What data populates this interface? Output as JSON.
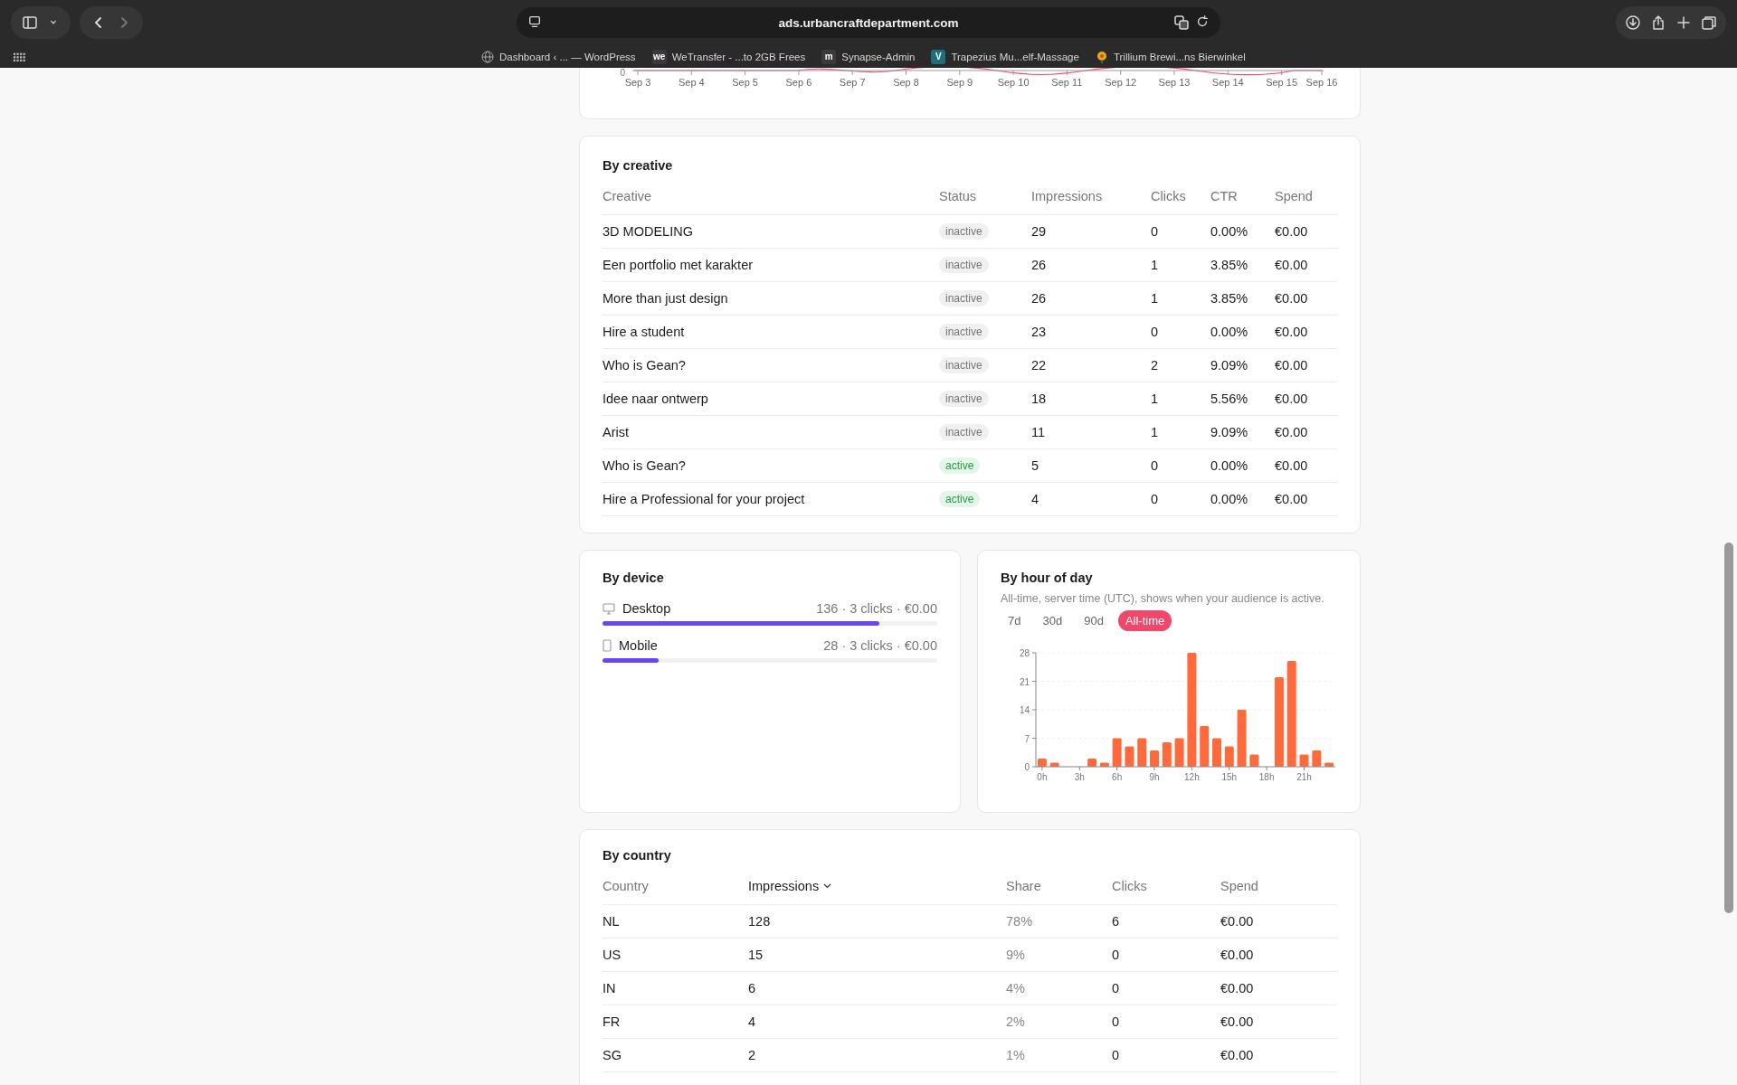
{
  "browser": {
    "url": "ads.urbancraftdepartment.com",
    "back_disabled": false,
    "forward_disabled": true,
    "bookmarks": [
      {
        "kind": "globe",
        "label": "Dashboard ‹ ... — WordPress"
      },
      {
        "kind": "badge",
        "badge": "we",
        "color": "#3a3a3a",
        "label": "WeTransfer - ...to 2GB Frees"
      },
      {
        "kind": "badge",
        "badge": "m",
        "color": "#3a3a3a",
        "label": "Synapse-Admin"
      },
      {
        "kind": "badge",
        "badge": "V",
        "color": "#1f6f7a",
        "label": "Trapezius Mu...elf-Massage"
      },
      {
        "kind": "flower",
        "label": "Trillium Brewi...ns Bierwinkel"
      }
    ]
  },
  "trend_chart": {
    "y_tick": "0",
    "x_labels": [
      "Sep 3",
      "Sep 4",
      "Sep 5",
      "Sep 6",
      "Sep 7",
      "Sep 8",
      "Sep 9",
      "Sep 10",
      "Sep 11",
      "Sep 12",
      "Sep 13",
      "Sep 14",
      "Sep 15",
      "Sep 16"
    ]
  },
  "by_creative": {
    "title": "By creative",
    "columns": [
      "Creative",
      "Status",
      "Impressions",
      "Clicks",
      "CTR",
      "Spend"
    ],
    "rows": [
      {
        "creative": "3D MODELING",
        "status": "inactive",
        "active": false,
        "impressions": "29",
        "clicks": "0",
        "ctr": "0.00%",
        "spend": "€0.00"
      },
      {
        "creative": "Een portfolio met karakter",
        "status": "inactive",
        "active": false,
        "impressions": "26",
        "clicks": "1",
        "ctr": "3.85%",
        "spend": "€0.00"
      },
      {
        "creative": "More than just design",
        "status": "inactive",
        "active": false,
        "impressions": "26",
        "clicks": "1",
        "ctr": "3.85%",
        "spend": "€0.00"
      },
      {
        "creative": "Hire a student",
        "status": "inactive",
        "active": false,
        "impressions": "23",
        "clicks": "0",
        "ctr": "0.00%",
        "spend": "€0.00"
      },
      {
        "creative": "Who is Gean?",
        "status": "inactive",
        "active": false,
        "impressions": "22",
        "clicks": "2",
        "ctr": "9.09%",
        "spend": "€0.00"
      },
      {
        "creative": "Idee naar ontwerp",
        "status": "inactive",
        "active": false,
        "impressions": "18",
        "clicks": "1",
        "ctr": "5.56%",
        "spend": "€0.00"
      },
      {
        "creative": "Arist",
        "status": "inactive",
        "active": false,
        "impressions": "11",
        "clicks": "1",
        "ctr": "9.09%",
        "spend": "€0.00"
      },
      {
        "creative": "Who is Gean?",
        "status": "active",
        "active": true,
        "impressions": "5",
        "clicks": "0",
        "ctr": "0.00%",
        "spend": "€0.00"
      },
      {
        "creative": "Hire a Professional for your project",
        "status": "active",
        "active": true,
        "impressions": "4",
        "clicks": "0",
        "ctr": "0.00%",
        "spend": "€0.00"
      }
    ]
  },
  "by_device": {
    "title": "By device",
    "rows": [
      {
        "kind": "desktop",
        "label": "Desktop",
        "stats": "136 · 3 clicks · €0.00",
        "level": 0.827
      },
      {
        "kind": "mobile",
        "label": "Mobile",
        "stats": "28 · 3 clicks · €0.00",
        "level": 0.167
      }
    ]
  },
  "by_hour": {
    "title": "By hour of day",
    "subtitle": "All-time, server time (UTC), shows when your audience is active.",
    "tabs": [
      {
        "label": "7d",
        "selected": false
      },
      {
        "label": "30d",
        "selected": false
      },
      {
        "label": "90d",
        "selected": false
      },
      {
        "label": "All-time",
        "selected": true
      }
    ],
    "chart_data": {
      "type": "bar",
      "x": [
        0,
        1,
        2,
        3,
        4,
        5,
        6,
        7,
        8,
        9,
        10,
        11,
        12,
        13,
        14,
        15,
        16,
        17,
        18,
        19,
        20,
        21,
        22,
        23
      ],
      "xlim": [
        -0.5,
        23.5
      ],
      "grid": true,
      "series": [
        {
          "color": "#ff6a3d",
          "values": [
            2,
            1,
            0,
            0,
            2,
            1,
            7,
            5,
            7,
            4,
            6,
            7,
            28,
            10,
            7,
            5,
            14,
            3,
            0,
            22,
            26,
            3,
            4,
            1
          ]
        }
      ],
      "ylim": [
        0,
        28
      ],
      "yticks": [
        0,
        7,
        14,
        21,
        28
      ],
      "xticks": [
        {
          "value": 0,
          "label": "0h"
        },
        {
          "value": 3,
          "label": "3h"
        },
        {
          "value": 6,
          "label": "6h"
        },
        {
          "value": 9,
          "label": "9h"
        },
        {
          "value": 12,
          "label": "12h"
        },
        {
          "value": 15,
          "label": "15h"
        },
        {
          "value": 18,
          "label": "18h"
        },
        {
          "value": 21,
          "label": "21h"
        }
      ]
    }
  },
  "by_country": {
    "title": "By country",
    "columns": [
      {
        "label": "Country",
        "sorted": false
      },
      {
        "label": "Impressions",
        "sorted": true
      },
      {
        "label": "Share",
        "sorted": false
      },
      {
        "label": "Clicks",
        "sorted": false
      },
      {
        "label": "Spend",
        "sorted": false
      }
    ],
    "rows": [
      {
        "country": "NL",
        "impressions": "128",
        "share": "78%",
        "clicks": "6",
        "spend": "€0.00"
      },
      {
        "country": "US",
        "impressions": "15",
        "share": "9%",
        "clicks": "0",
        "spend": "€0.00"
      },
      {
        "country": "IN",
        "impressions": "6",
        "share": "4%",
        "clicks": "0",
        "spend": "€0.00"
      },
      {
        "country": "FR",
        "impressions": "4",
        "share": "2%",
        "clicks": "0",
        "spend": "€0.00"
      },
      {
        "country": "SG",
        "impressions": "2",
        "share": "1%",
        "clicks": "0",
        "spend": "€0.00"
      }
    ]
  }
}
